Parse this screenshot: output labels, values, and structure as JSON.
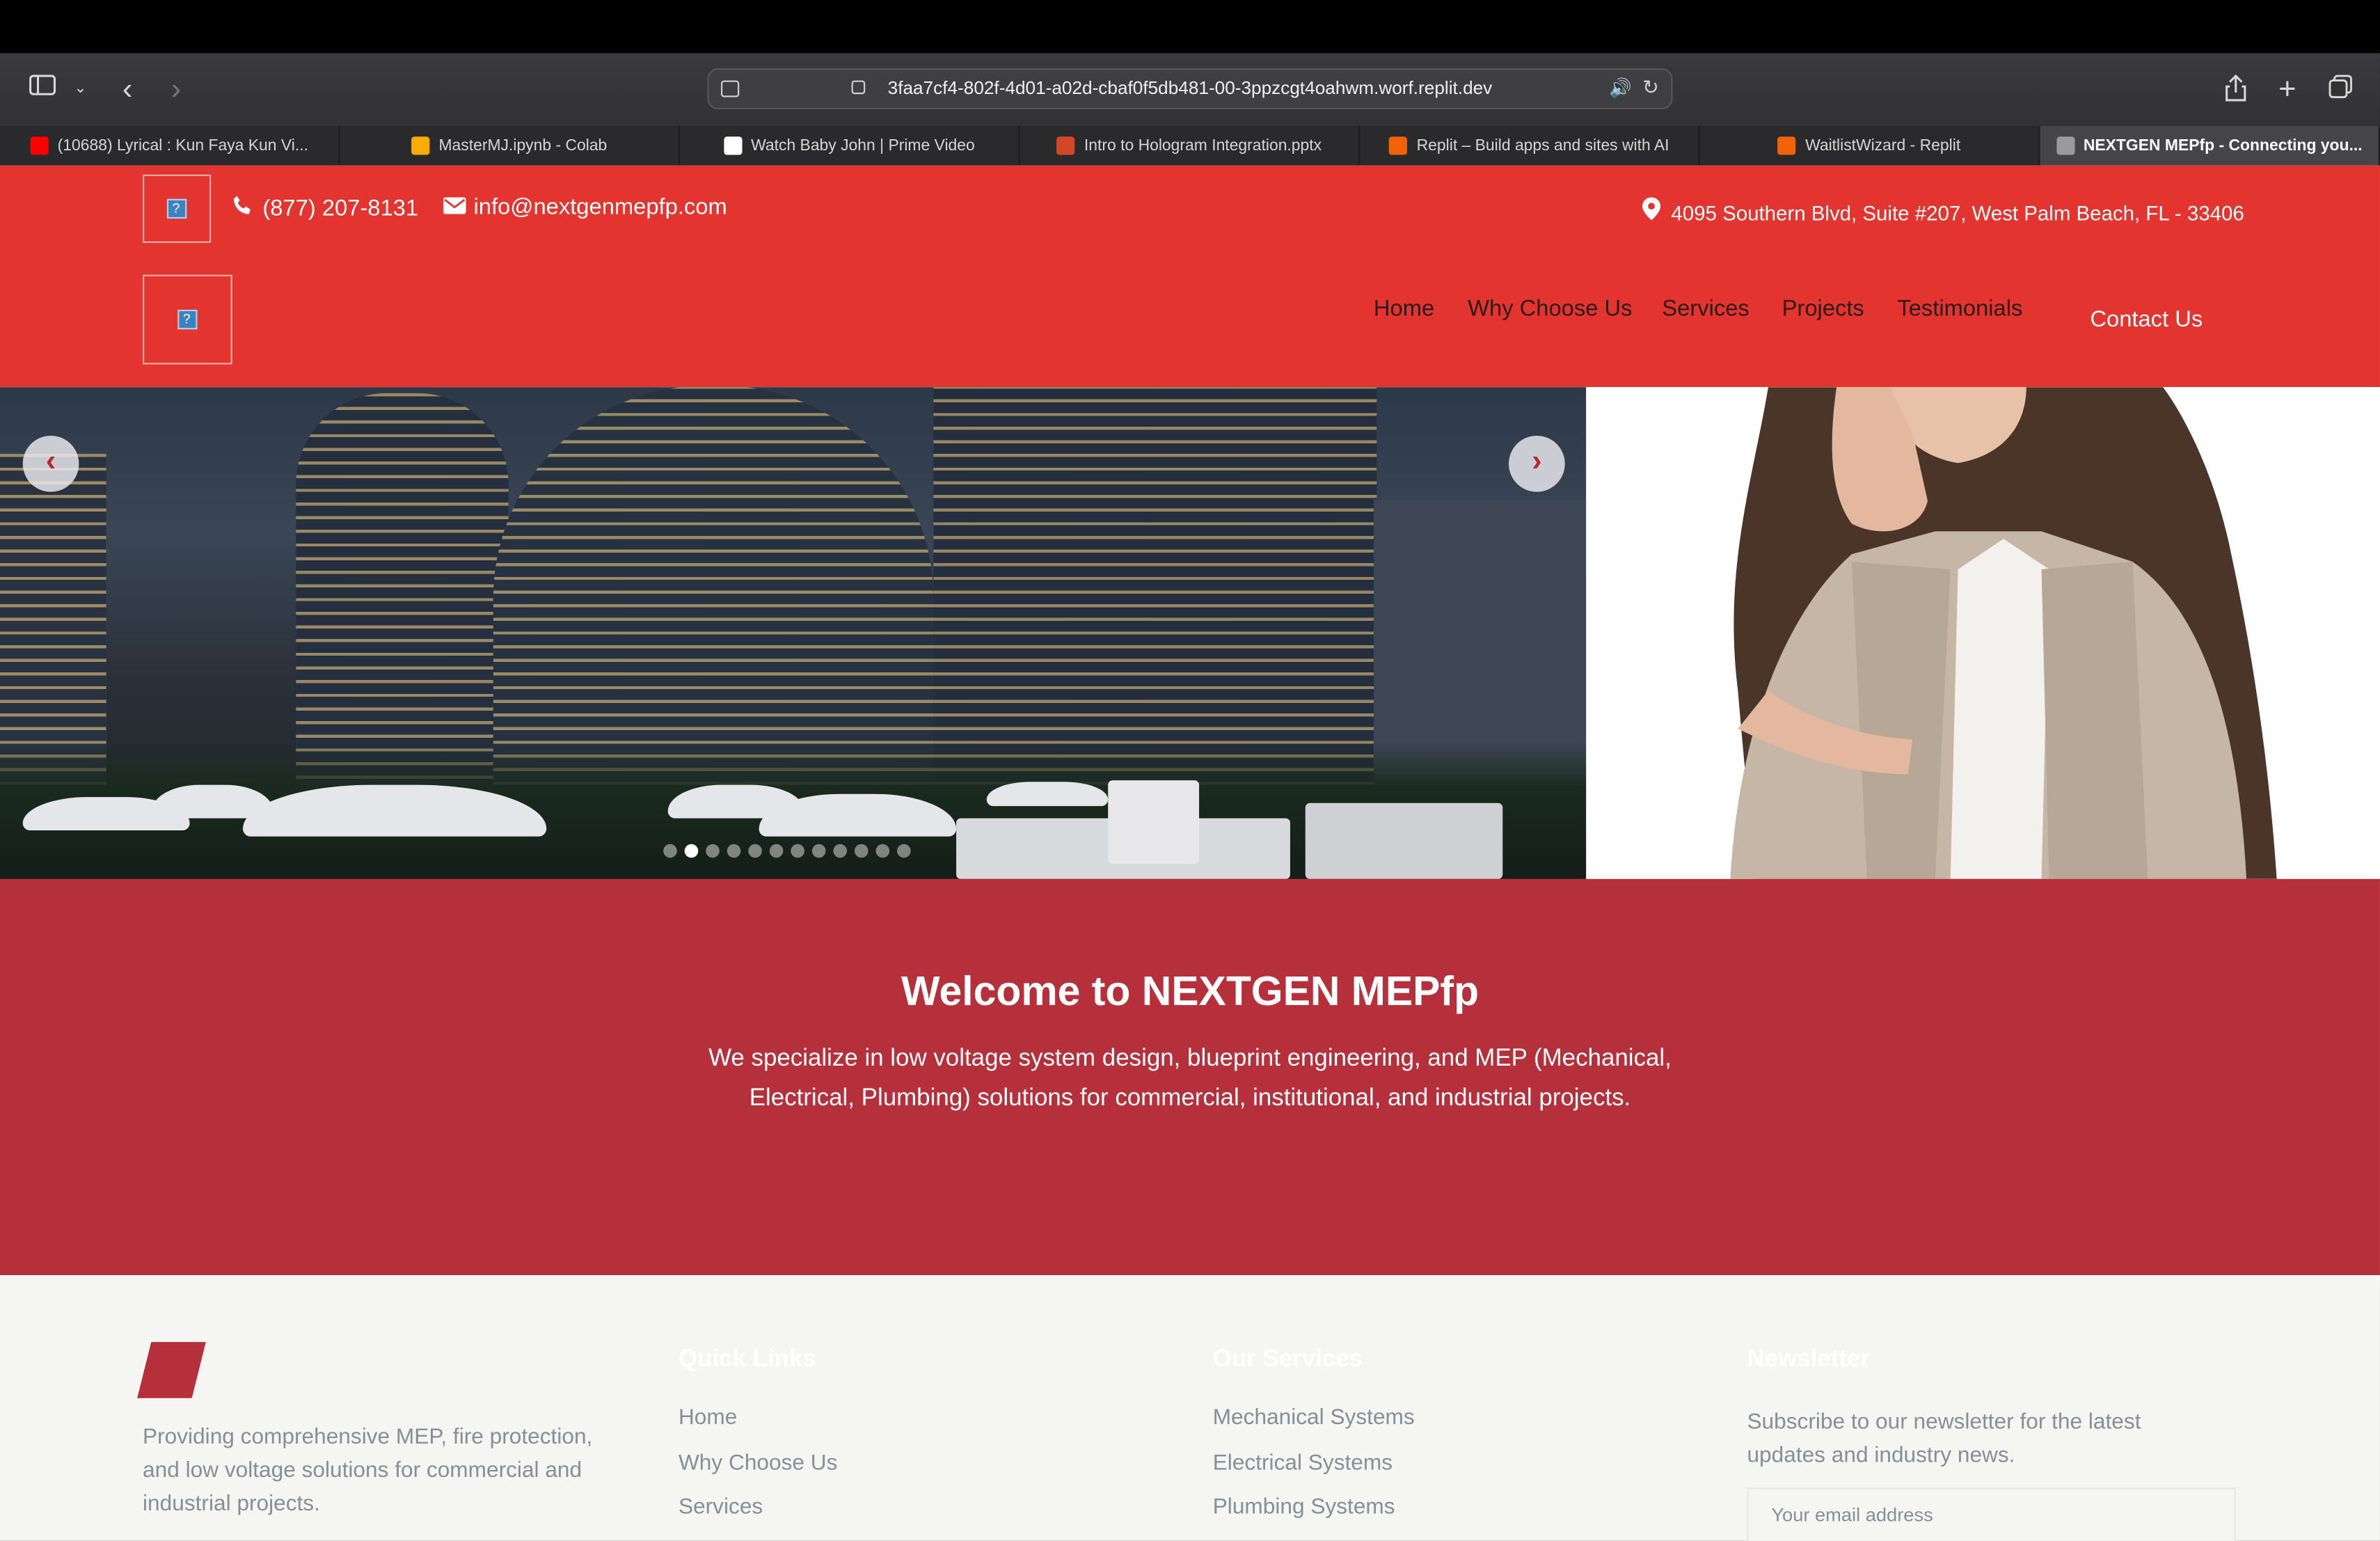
{
  "browser": {
    "url": "3faa7cf4-802f-4d01-a02d-cbaf0f5db481-00-3ppzcgt4oahwm.worf.replit.dev",
    "tabs": [
      {
        "label": "(10688) Lyrical : Kun Faya Kun Vi...",
        "icon": "youtube-icon",
        "color": "#ff0000"
      },
      {
        "label": "MasterMJ.ipynb - Colab",
        "icon": "colab-icon",
        "color": "#f9ab00"
      },
      {
        "label": "Watch Baby John | Prime Video",
        "icon": "amazon-icon",
        "color": "#ffffff"
      },
      {
        "label": "Intro to Hologram Integration.pptx",
        "icon": "powerpoint-icon",
        "color": "#d24726"
      },
      {
        "label": "Replit – Build apps and sites with AI",
        "icon": "replit-icon",
        "color": "#f26207"
      },
      {
        "label": "WaitlistWizard - Replit",
        "icon": "replit-icon",
        "color": "#f26207"
      },
      {
        "label": "NEXTGEN MEPfp - Connecting you...",
        "icon": "r-icon",
        "color": "#9a9a9a",
        "active": true
      }
    ]
  },
  "topbar": {
    "phone": "(877) 207-8131",
    "email": "info@nextgenmepfp.com",
    "address": "4095 Southern Blvd, Suite #207, West Palm Beach, FL - 33406"
  },
  "nav": {
    "items": [
      "Home",
      "Why Choose Us",
      "Services",
      "Projects",
      "Testimonials"
    ],
    "contact": "Contact Us"
  },
  "hero": {
    "slide_count": 12,
    "active_slide": 2
  },
  "welcome": {
    "title": "Welcome to NEXTGEN MEPfp",
    "text": "We specialize in low voltage system design, blueprint engineering, and MEP (Mechanical, Electrical, Plumbing) solutions for commercial, institutional, and industrial projects."
  },
  "footer": {
    "description": "Providing comprehensive MEP, fire protection, and low voltage solutions for commercial and industrial projects.",
    "quick_links": {
      "title": "Quick Links",
      "items": [
        "Home",
        "Why Choose Us",
        "Services"
      ]
    },
    "services": {
      "title": "Our Services",
      "items": [
        "Mechanical Systems",
        "Electrical Systems",
        "Plumbing Systems"
      ]
    },
    "newsletter": {
      "title": "Newsletter",
      "text": "Subscribe to our newsletter for the latest updates and industry news.",
      "placeholder": "Your email address"
    }
  },
  "colors": {
    "brand_red": "#e3342f",
    "band_red": "#b5303b"
  }
}
